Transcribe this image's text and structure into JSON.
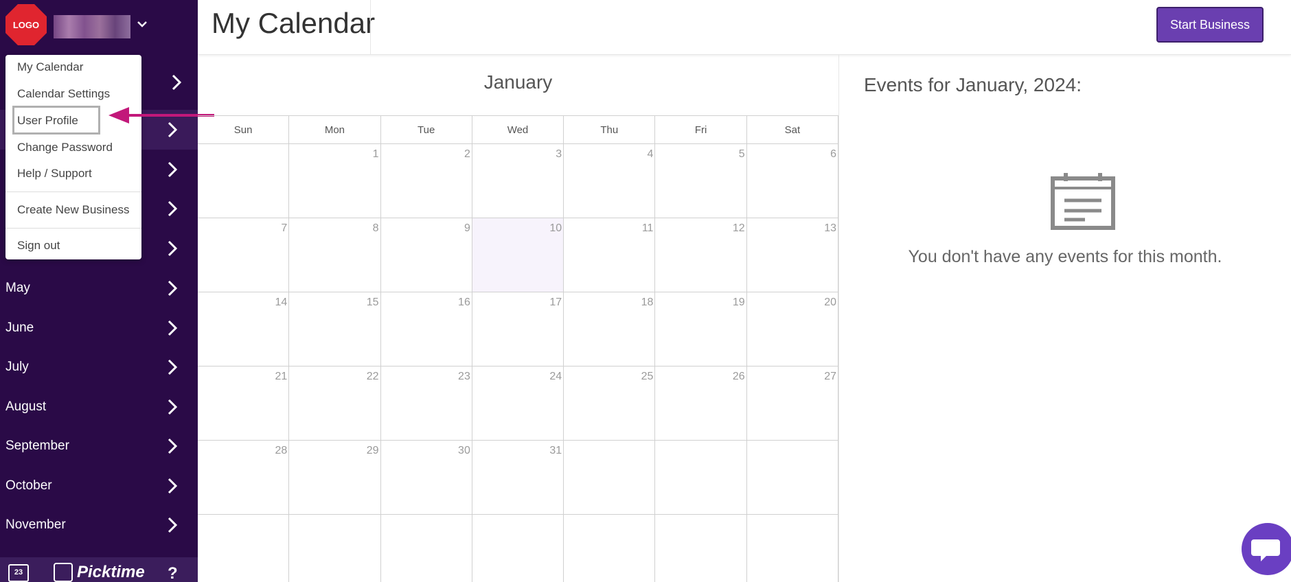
{
  "app": {
    "logo_text": "LOGO",
    "brand_name": "Picktime",
    "calendar_icon_day": "23",
    "help_symbol": "?"
  },
  "colors": {
    "sidebar_bg": "#2a0a47",
    "accent": "#6a3fb0",
    "highlight_arrow": "#c2187a",
    "logo_red": "#e0252f"
  },
  "header": {
    "title": "My Calendar",
    "start_button": "Start Business"
  },
  "dropdown": {
    "items": [
      "My Calendar",
      "Calendar Settings",
      "User Profile",
      "Change Password",
      "Help / Support",
      "Create New Business",
      "Sign out"
    ],
    "highlighted": "User Profile"
  },
  "sidebar": {
    "months": [
      "May",
      "June",
      "July",
      "August",
      "September",
      "October",
      "November"
    ]
  },
  "calendar": {
    "month": "January",
    "weekdays": [
      "Sun",
      "Mon",
      "Tue",
      "Wed",
      "Thu",
      "Fri",
      "Sat"
    ],
    "days": [
      "",
      "1",
      "2",
      "3",
      "4",
      "5",
      "6",
      "7",
      "8",
      "9",
      "10",
      "11",
      "12",
      "13",
      "14",
      "15",
      "16",
      "17",
      "18",
      "19",
      "20",
      "21",
      "22",
      "23",
      "24",
      "25",
      "26",
      "27",
      "28",
      "29",
      "30",
      "31",
      "",
      "",
      "",
      "",
      "",
      "",
      "",
      "",
      "",
      ""
    ],
    "today": "10"
  },
  "events": {
    "title": "Events for January, 2024:",
    "empty_message": "You don't have any events for this month."
  },
  "icons": [
    "chevron-right-icon",
    "chevron-down-icon",
    "calendar-icon",
    "chat-icon",
    "event-empty-icon"
  ]
}
